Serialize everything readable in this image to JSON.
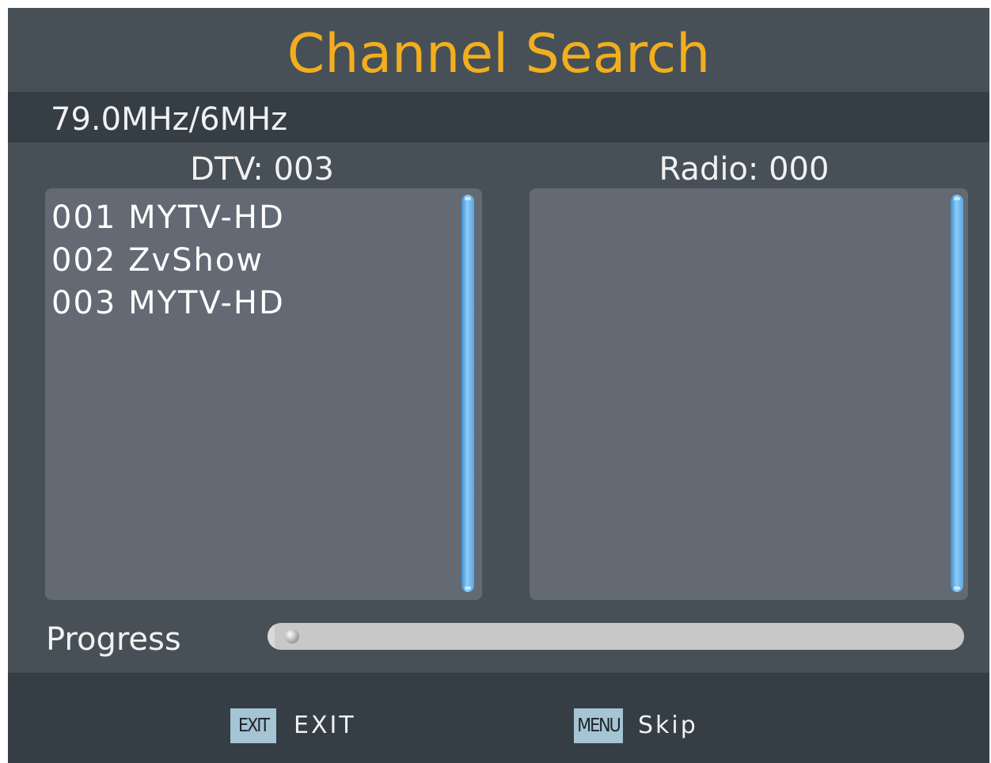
{
  "title": "Channel Search",
  "frequency": "79.0MHz/6MHz",
  "dtv": {
    "count_label": "DTV: 003",
    "channels": [
      "001 MYTV-HD",
      "002 ZvShow",
      "003 MYTV-HD"
    ]
  },
  "radio": {
    "count_label": "Radio: 000",
    "channels": []
  },
  "progress": {
    "label": "Progress",
    "percent": 1
  },
  "footer": {
    "exit_key": "EXIT",
    "exit_label": "EXIT",
    "menu_key": "MENU",
    "menu_label": "Skip"
  },
  "colors": {
    "title": "#f3ae1e",
    "background": "#475057",
    "panel": "#636a73",
    "scrollbar": "#8ccdf7"
  }
}
